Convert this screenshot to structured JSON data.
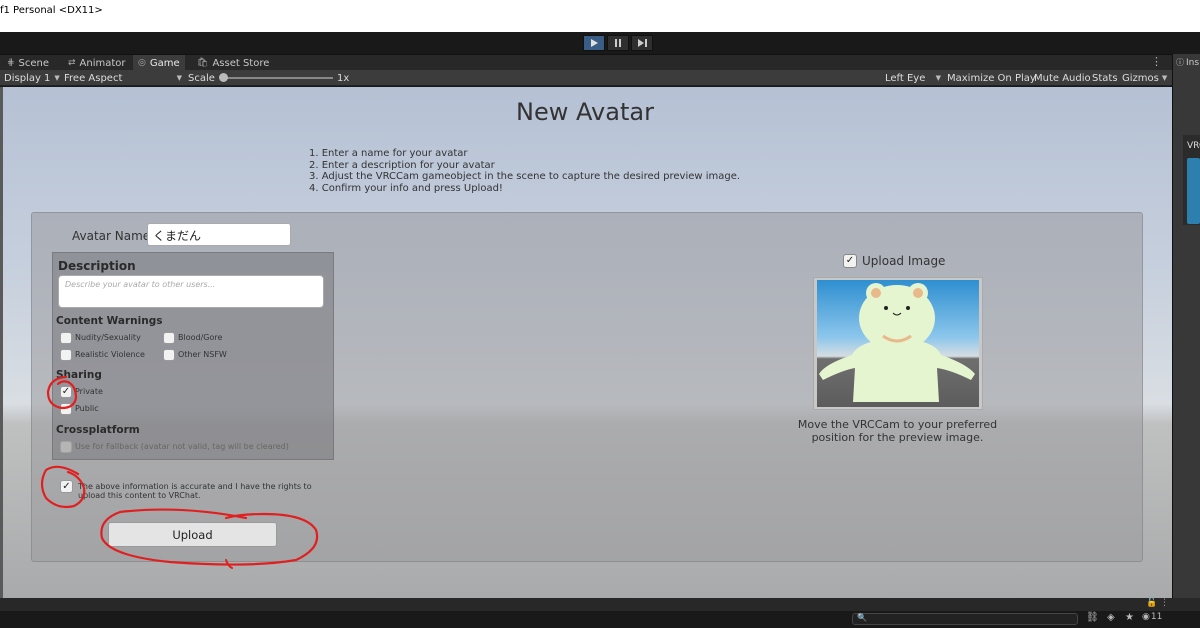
{
  "window": {
    "title": "f1 Personal <DX11>"
  },
  "tabs": [
    {
      "label": "Scene",
      "icon": "grid-icon"
    },
    {
      "label": "Animator",
      "icon": "animator-icon"
    },
    {
      "label": "Game",
      "icon": "gamepad-icon"
    },
    {
      "label": "Asset Store",
      "icon": "shopping-bag-icon"
    }
  ],
  "game_toolbar": {
    "display": "Display 1",
    "aspect": "Free Aspect",
    "scale_label": "Scale",
    "scale_value": "1x",
    "eye": "Left Eye",
    "maximize": "Maximize On Play",
    "mute": "Mute Audio",
    "stats": "Stats",
    "gizmos": "Gizmos"
  },
  "inspector": {
    "tab_label": "Ins",
    "section_label": "VRC"
  },
  "panel": {
    "title": "New Avatar",
    "instructions": [
      "1. Enter a name for your avatar",
      "2. Enter a description for your avatar",
      "3. Adjust the VRCCam gameobject in the scene to capture the desired preview image.",
      "4. Confirm your info and press Upload!"
    ],
    "avatar_name_label": "Avatar Name",
    "avatar_name_value": "くまだん",
    "description_label": "Description",
    "description_placeholder": "Describe your avatar to other users...",
    "content_warnings_label": "Content Warnings",
    "warnings": [
      "Nudity/Sexuality",
      "Blood/Gore",
      "Realistic Violence",
      "Other NSFW"
    ],
    "sharing_label": "Sharing",
    "sharing_private": "Private",
    "sharing_public": "Public",
    "crossplatform_label": "Crossplatform",
    "fallback_label": "Use for Fallback (avatar not valid, tag will be cleared)",
    "agreement": "The above information is accurate and I have the rights to upload this content to VRChat.",
    "upload_button": "Upload",
    "upload_image_label": "Upload Image",
    "preview_caption": "Move the VRCCam to your preferred position for the preview image."
  },
  "statusbar": {
    "layer_count": "11"
  },
  "colors": {
    "annotation": "#e02020",
    "play_active": "#3a5d86"
  }
}
